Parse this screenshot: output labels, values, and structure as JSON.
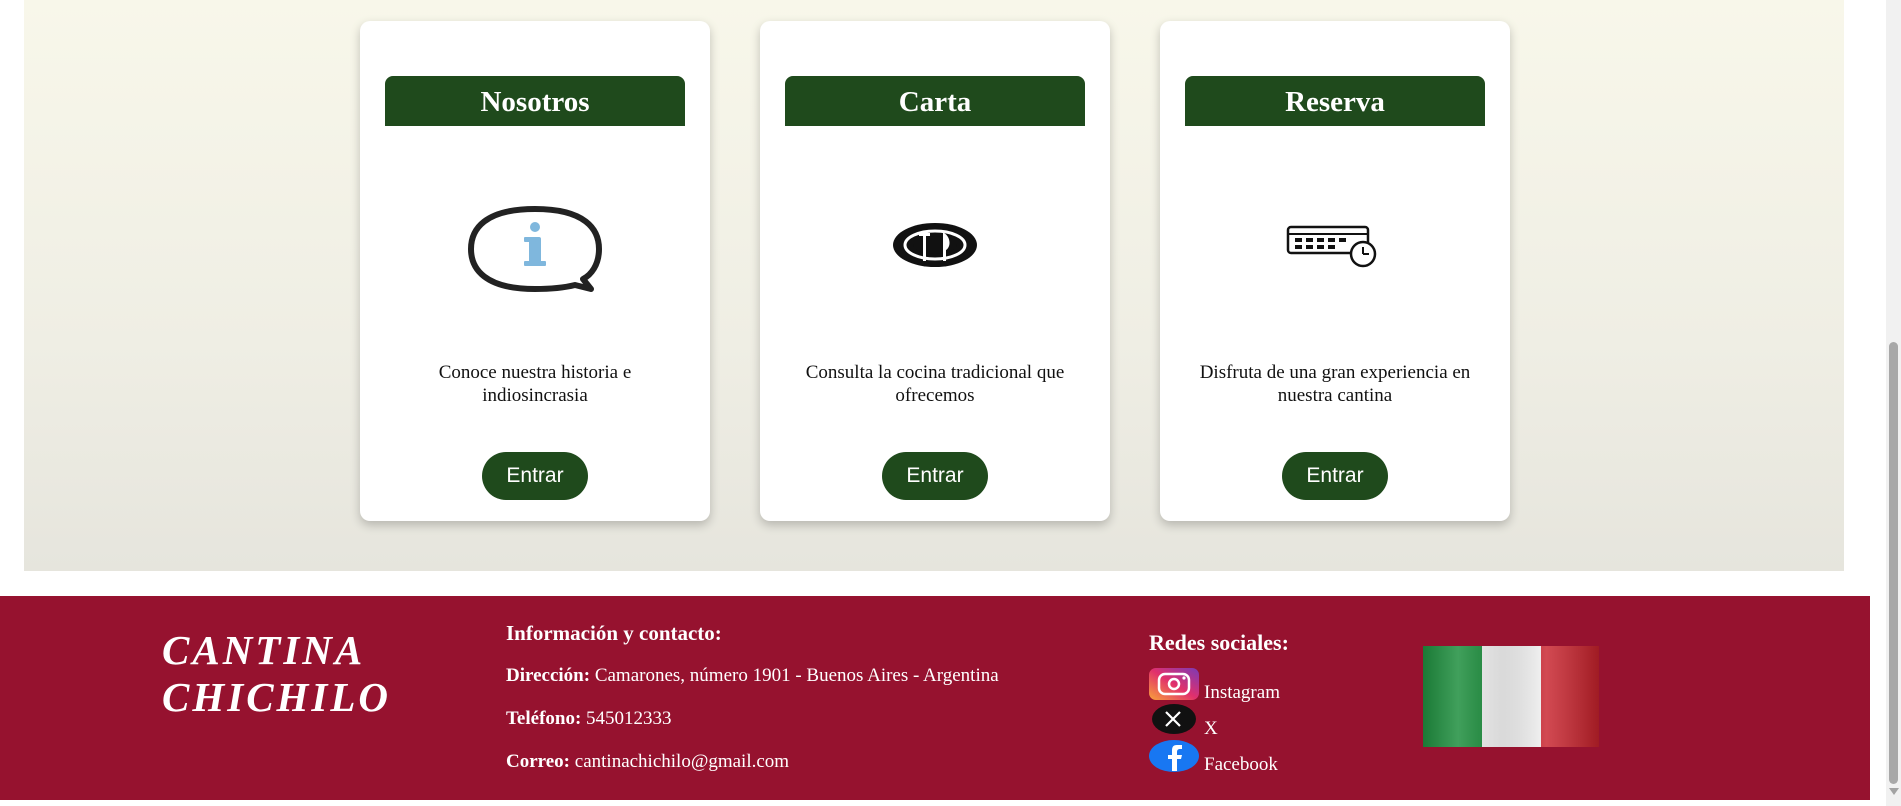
{
  "cards": [
    {
      "title": "Nosotros",
      "icon": "info-bubble-icon",
      "description": "Conoce nuestra historia e indiosincrasia",
      "button": "Entrar"
    },
    {
      "title": "Carta",
      "icon": "plate-cutlery-icon",
      "description": "Consulta la cocina tradicional que ofrecemos",
      "button": "Entrar"
    },
    {
      "title": "Reserva",
      "icon": "calendar-clock-icon",
      "description": "Disfruta de una gran experiencia en nuestra cantina",
      "button": "Entrar"
    }
  ],
  "footer": {
    "brand": "CANTINA CHICHILO",
    "contact": {
      "title": "Información y contacto:",
      "address_label": "Dirección:",
      "address": "Camarones, número 1901 - Buenos Aires - Argentina",
      "phone_label": "Teléfono:",
      "phone": "545012333",
      "email_label": "Correo:",
      "email": "cantinachichilo@gmail.com"
    },
    "social": {
      "title": "Redes sociales:",
      "items": [
        {
          "label": "Instagram",
          "icon": "instagram-icon"
        },
        {
          "label": "X",
          "icon": "x-icon"
        },
        {
          "label": "Facebook",
          "icon": "facebook-icon"
        }
      ]
    },
    "flag": "italy-flag"
  },
  "colors": {
    "accent_green": "#1f4a1c",
    "footer_burgundy": "#96122f",
    "hero_background": "#f3f2e6",
    "info_blue": "#7fb7dd"
  }
}
